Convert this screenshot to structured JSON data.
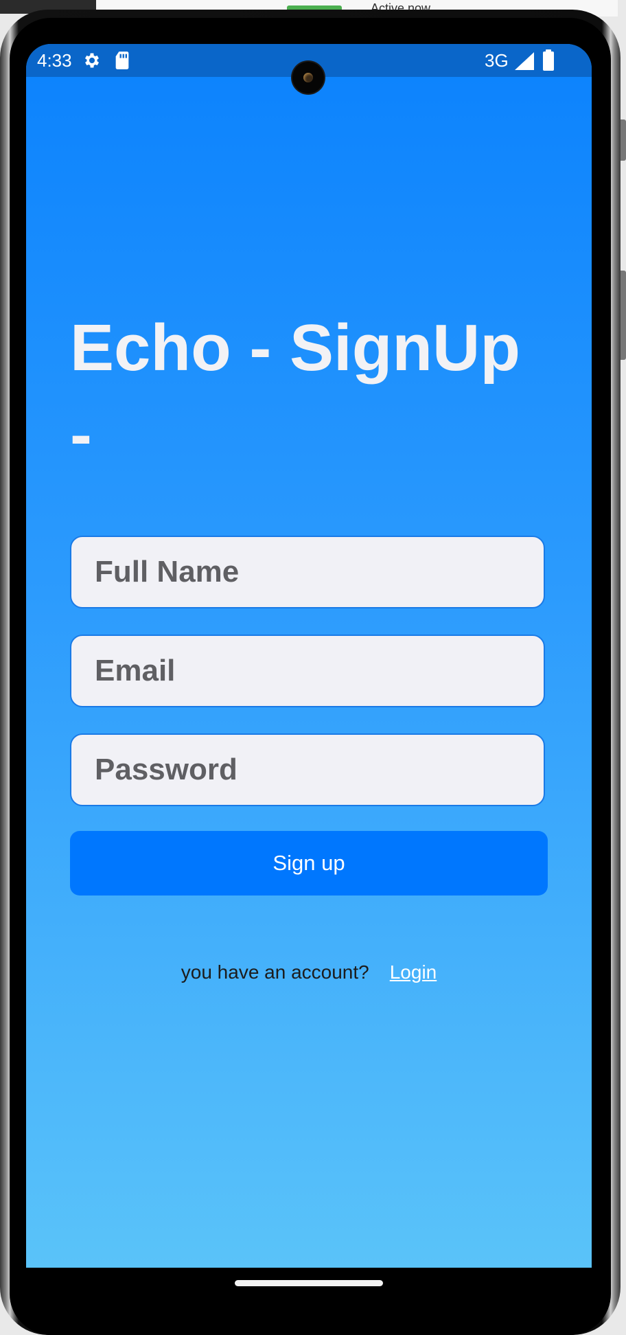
{
  "background_window": {
    "text": "Active now"
  },
  "status_bar": {
    "time": "4:33",
    "network": "3G",
    "icons": [
      "gear-icon",
      "sd-card-icon",
      "signal-icon",
      "battery-icon"
    ]
  },
  "app": {
    "title": "Echo - SignUp -",
    "form": {
      "full_name_placeholder": "Full Name",
      "email_placeholder": "Email",
      "password_placeholder": "Password",
      "submit_label": "Sign up"
    },
    "footer": {
      "prompt": "you have an account?",
      "login_label": "Login"
    }
  },
  "colors": {
    "status_bar": "#0a66c9",
    "gradient_top": "#0b82fd",
    "gradient_bottom": "#5ac3f9",
    "button": "#0077fe",
    "input_bg": "#f1f1f6",
    "input_border": "#1a7ae6",
    "title_text": "#f2f2f5"
  }
}
